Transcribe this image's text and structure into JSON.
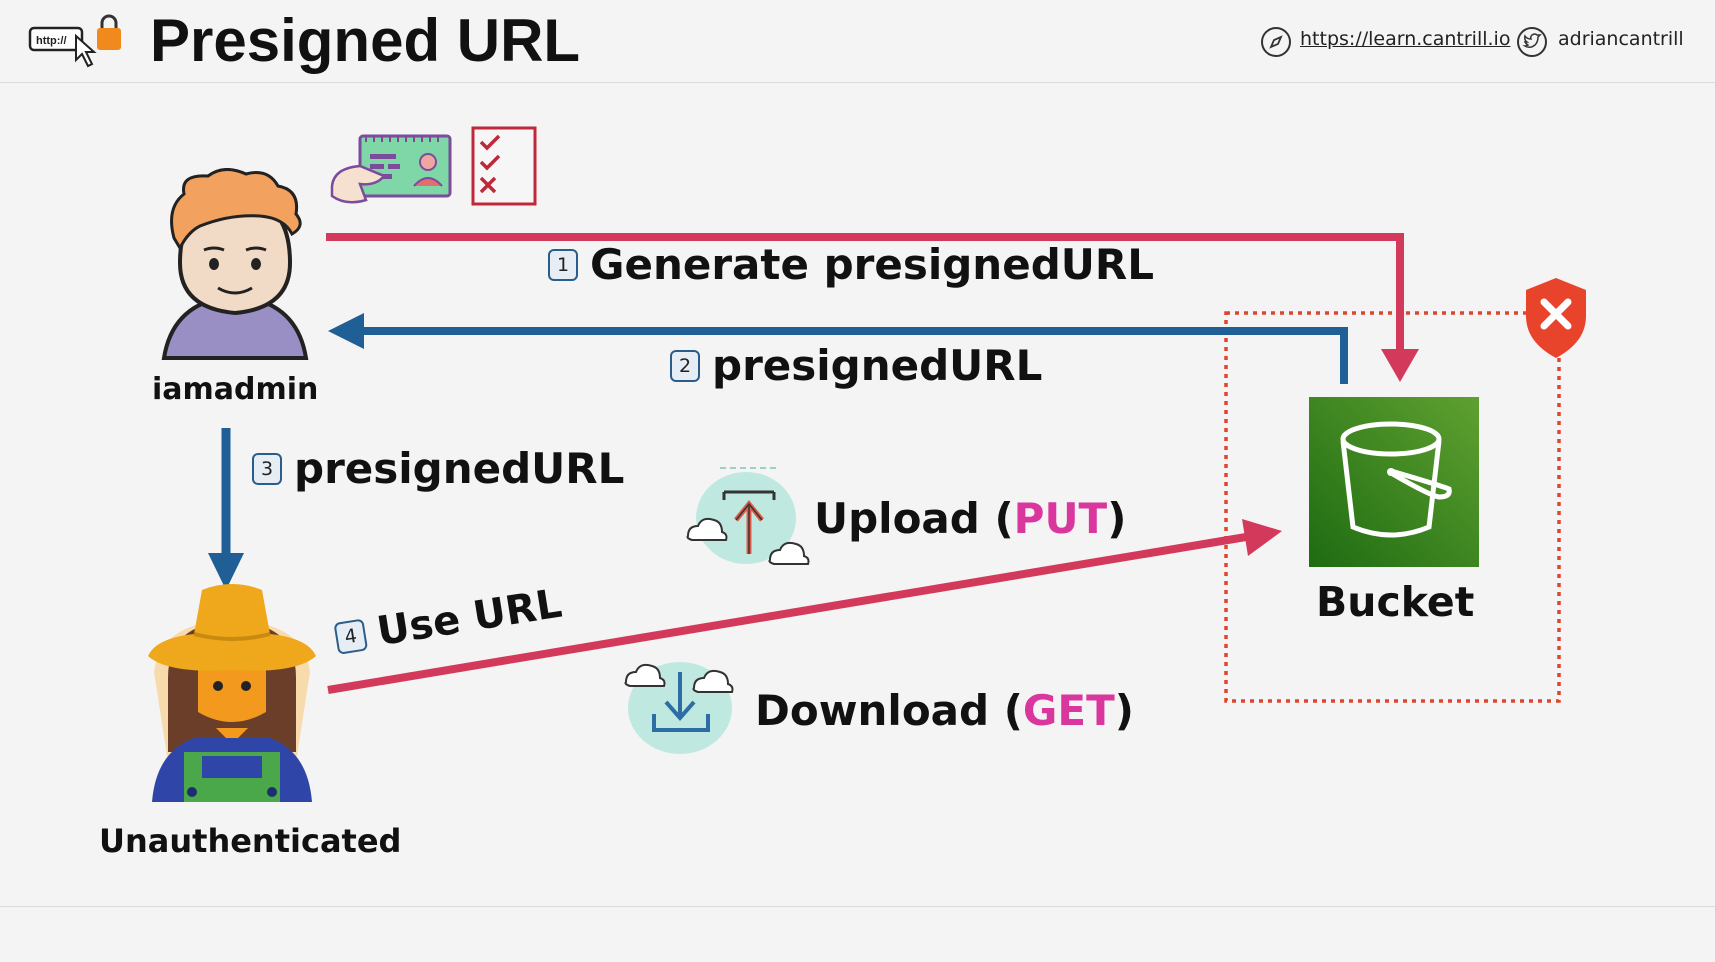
{
  "header": {
    "title": "Presigned URL",
    "website": "https://learn.cantrill.io",
    "twitter_handle": "adriancantrill",
    "logo_text": "http://"
  },
  "actors": {
    "admin_label": "iamadmin",
    "user_label": "Unauthenticated",
    "bucket_label": "Bucket"
  },
  "steps": [
    {
      "number": "1",
      "text": "Generate presignedURL"
    },
    {
      "number": "2",
      "text": "presignedURL"
    },
    {
      "number": "3",
      "text": "presignedURL"
    },
    {
      "number": "4",
      "text": "Use URL"
    }
  ],
  "operations": {
    "upload_prefix": "Upload (",
    "upload_method": "PUT",
    "upload_suffix": ")",
    "download_prefix": "Download (",
    "download_method": "GET",
    "download_suffix": ")"
  },
  "colors": {
    "red_arrow": "#d2395a",
    "blue_arrow": "#1f5f95",
    "bucket_green": "#3f8624",
    "boundary": "#e0452c",
    "method": "#d9369e"
  }
}
